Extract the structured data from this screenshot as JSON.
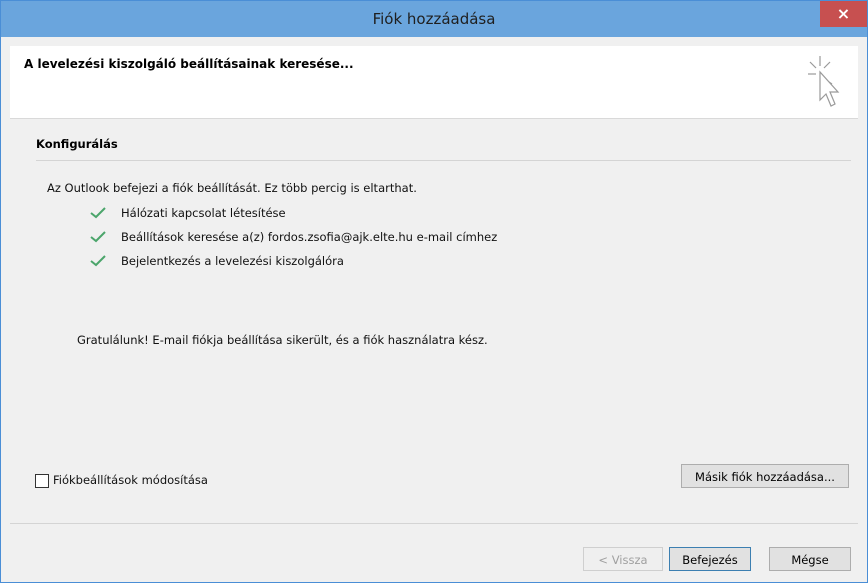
{
  "window": {
    "title": "Fiók hozzáadása",
    "close_label": "×"
  },
  "header": {
    "title": "A levelezési kiszolgáló beállításainak keresése..."
  },
  "section": {
    "title": "Konfigurálás",
    "intro": "Az Outlook befejezi a fiók beállítását. Ez több percig is eltarthat.",
    "steps": [
      "Hálózati kapcsolat létesítése",
      "Beállítások keresése a(z) fordos.zsofia@ajk.elte.hu e-mail címhez",
      "Bejelentkezés a levelezési kiszolgálóra"
    ],
    "success": "Gratulálunk! E-mail fiókja beállítása sikerült, és a fiók használatra kész."
  },
  "options": {
    "change_settings_label": "Fiókbeállítások módosítása",
    "change_settings_checked": false,
    "add_another_label": "Másik fiók hozzáadása..."
  },
  "footer": {
    "back_label": "< Vissza",
    "finish_label": "Befejezés",
    "cancel_label": "Mégse"
  },
  "colors": {
    "titlebar": "#6aa5dd",
    "close": "#c75050",
    "check": "#4ba56b"
  }
}
